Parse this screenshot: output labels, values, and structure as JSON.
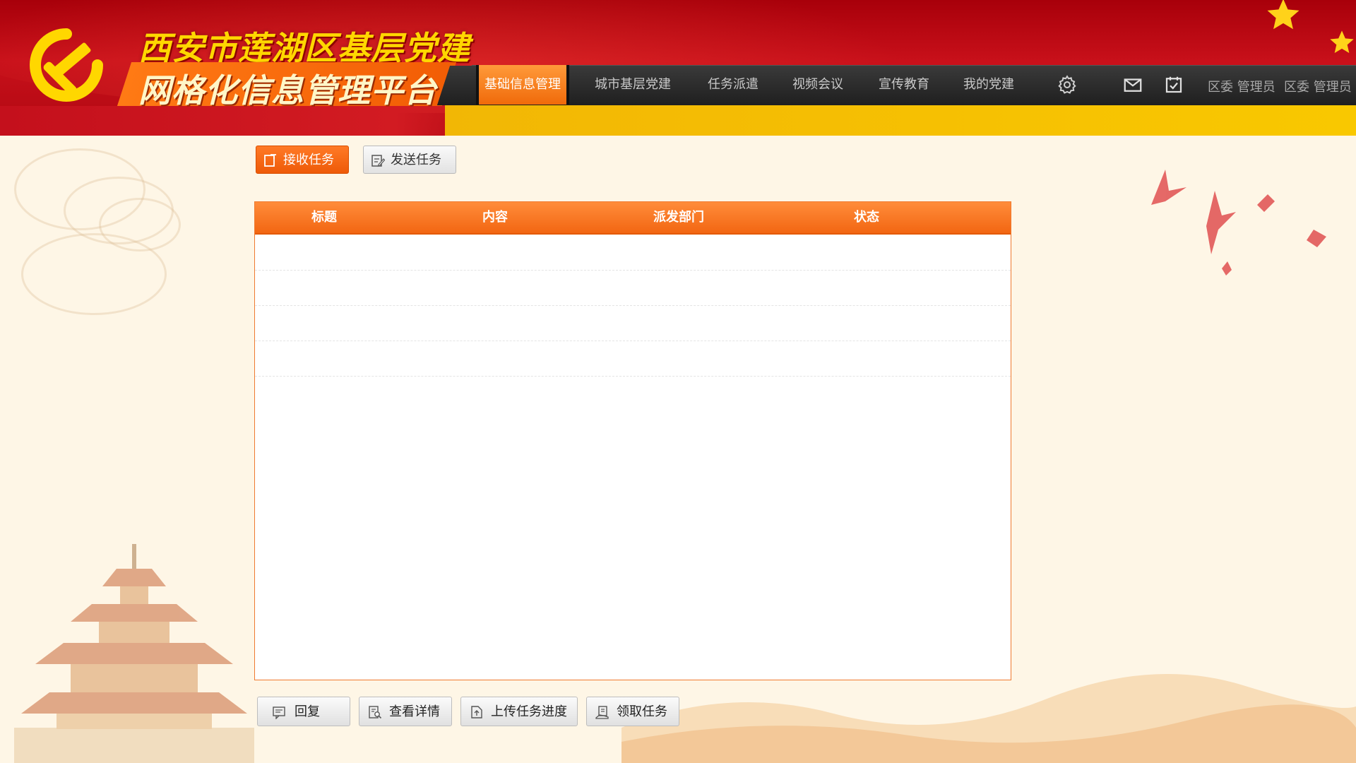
{
  "header": {
    "title_line1": "西安市莲湖区基层党建",
    "title_line2": "网格化信息管理平台",
    "nav": [
      {
        "label": "基础信息管理",
        "active": true
      },
      {
        "label": "城市基层党建",
        "active": false
      },
      {
        "label": "任务派遣",
        "active": false
      },
      {
        "label": "视频会议",
        "active": false
      },
      {
        "label": "宣传教育",
        "active": false
      },
      {
        "label": "我的党建",
        "active": false
      }
    ],
    "icons": [
      "gear-icon",
      "mail-icon",
      "calendar-check-icon"
    ],
    "user_1": "区委 管理员",
    "user_2": "区委 管理员"
  },
  "toolbar": {
    "receive_task_label": "接收任务",
    "send_task_label": "发送任务"
  },
  "table": {
    "columns": [
      "标题",
      "内容",
      "派发部门",
      "状态"
    ],
    "rows": []
  },
  "actions": {
    "reply_label": "回复",
    "view_details_label": "查看详情",
    "upload_progress_label": "上传任务进度",
    "claim_task_label": "领取任务"
  },
  "colors": {
    "brand_red": "#c8101a",
    "accent_orange": "#f26612",
    "yellow": "#f9c800",
    "nav_dark": "#2a2a2a"
  }
}
